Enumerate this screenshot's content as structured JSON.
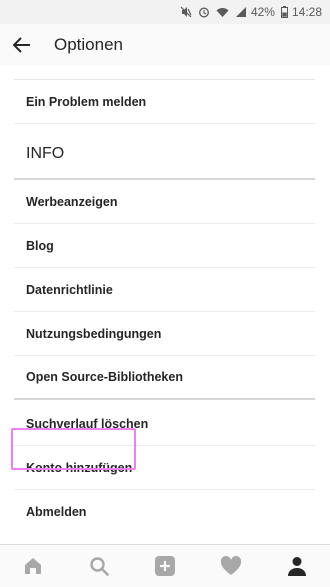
{
  "status_bar": {
    "battery_percent": "42%",
    "time": "14:28"
  },
  "header": {
    "title": "Optionen",
    "back_icon": "arrow-left-icon"
  },
  "support_section": {
    "items": [
      {
        "label": "Ein Problem melden"
      }
    ]
  },
  "info_section": {
    "title": "INFO",
    "items": [
      {
        "label": "Werbeanzeigen"
      },
      {
        "label": "Blog"
      },
      {
        "label": "Datenrichtlinie"
      },
      {
        "label": "Nutzungsbedingungen"
      },
      {
        "label": "Open Source-Bibliotheken"
      }
    ]
  },
  "account_section": {
    "items": [
      {
        "label": "Suchverlauf löschen"
      },
      {
        "label": "Konto hinzufügen"
      },
      {
        "label": "Abmelden"
      }
    ]
  },
  "bottom_nav": {
    "items": [
      {
        "icon": "home-icon"
      },
      {
        "icon": "search-icon"
      },
      {
        "icon": "add-post-icon"
      },
      {
        "icon": "heart-icon"
      },
      {
        "icon": "profile-icon"
      }
    ]
  },
  "colors": {
    "highlight": "#f07ef5",
    "divider": "#d6d6d6",
    "nav_icon": "#a8a8a8"
  }
}
